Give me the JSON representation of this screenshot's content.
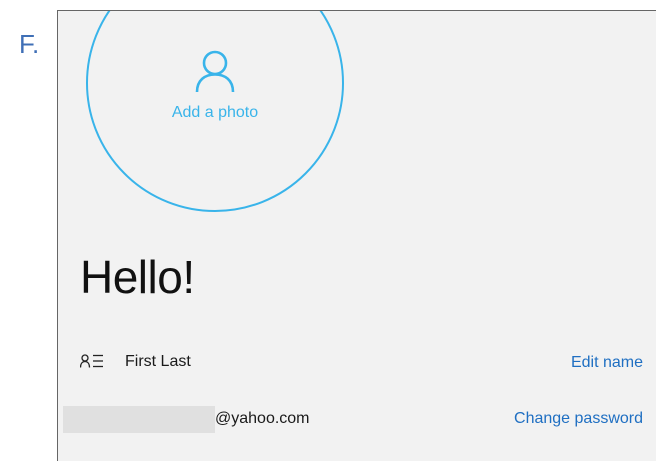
{
  "step_label": "F.",
  "profile": {
    "add_photo_label": "Add a photo",
    "greeting": "Hello!",
    "name": "First Last",
    "edit_name_label": "Edit name",
    "email_suffix": "@yahoo.com",
    "change_password_label": "Change password"
  },
  "icons": {
    "photo": "person-icon",
    "name": "contact-card-icon"
  },
  "colors": {
    "accent": "#39b4ea",
    "link": "#1f6fc2",
    "step_label": "#3f6fb6",
    "panel_background": "#f2f2f2"
  }
}
